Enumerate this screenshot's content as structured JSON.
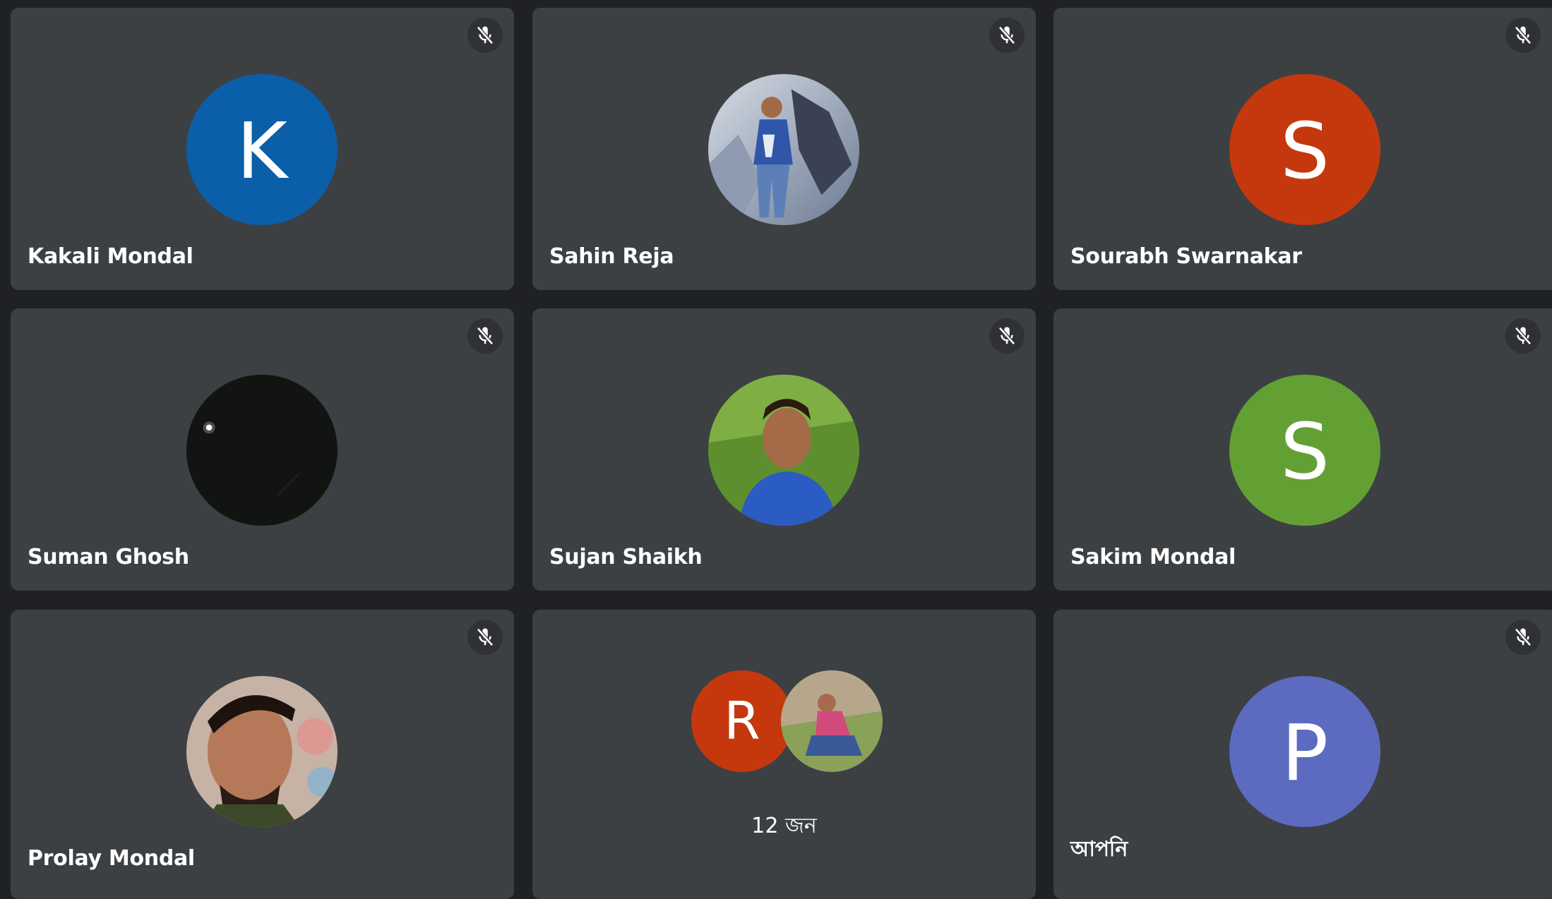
{
  "participants": [
    {
      "name": "Kakali Mondal",
      "avatar_type": "letter",
      "initial": "K",
      "color": "#0b5ea8",
      "muted": true
    },
    {
      "name": "Sahin Reja",
      "avatar_type": "photo",
      "photo": "man standing near rocks in blue jacket",
      "muted": true
    },
    {
      "name": "Sourabh Swarnakar",
      "avatar_type": "letter",
      "initial": "S",
      "color": "#c5380d",
      "muted": true
    },
    {
      "name": "Suman Ghosh",
      "avatar_type": "photo",
      "photo": "dark night sky with single light",
      "muted": true
    },
    {
      "name": "Sujan Shaikh",
      "avatar_type": "photo",
      "photo": "young man in blue sweater on grass",
      "muted": true
    },
    {
      "name": "Sakim Mondal",
      "avatar_type": "letter",
      "initial": "S",
      "color": "#63a034",
      "muted": true
    },
    {
      "name": "Prolay Mondal",
      "avatar_type": "photo",
      "photo": "close-up selfie of young man",
      "muted": true
    },
    {
      "name": "আপনি",
      "avatar_type": "letter",
      "initial": "P",
      "color": "#5c6bc0",
      "muted": true
    }
  ],
  "others_tile": {
    "count_label": "12 জন",
    "avatars": [
      {
        "avatar_type": "letter",
        "initial": "R",
        "color": "#c5380d"
      },
      {
        "avatar_type": "photo",
        "photo": "woman sitting outdoors on grass"
      }
    ]
  },
  "icons": {
    "mic_muted": "mic-off-icon"
  },
  "colors": {
    "background": "#202124",
    "tile": "#3c4043"
  }
}
